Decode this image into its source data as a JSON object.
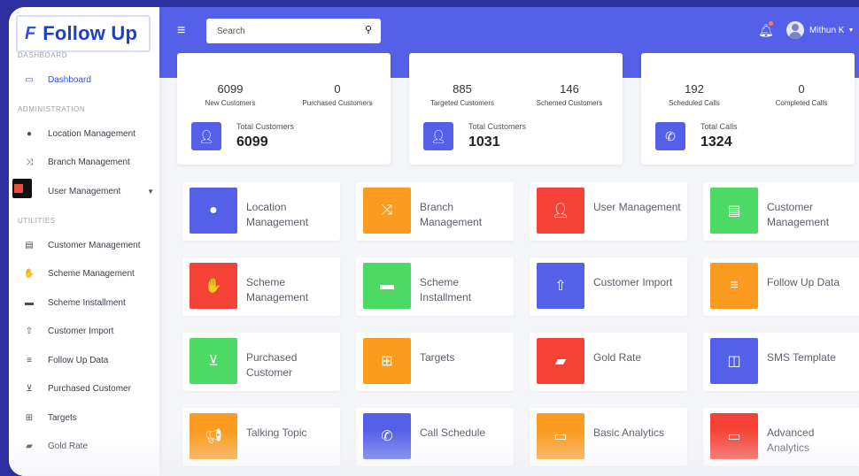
{
  "app": {
    "logo_mark": "F",
    "logo_text": "Follow Up"
  },
  "sidebar": {
    "sections": [
      {
        "label": "DASHBOARD"
      },
      {
        "label": "ADMINISTRATION"
      },
      {
        "label": "UTILITIES"
      }
    ],
    "items": [
      {
        "label": "Dashboard",
        "icon": "monitor-icon",
        "active": true
      },
      {
        "label": "Location Management",
        "icon": "location-pin-icon"
      },
      {
        "label": "Branch Management",
        "icon": "shuffle-icon"
      },
      {
        "label": "User Management",
        "icon": "user-icon"
      },
      {
        "label": "Customer Management",
        "icon": "id-card-icon"
      },
      {
        "label": "Scheme Management",
        "icon": "handshake-icon"
      },
      {
        "label": "Scheme Installment",
        "icon": "card-icon"
      },
      {
        "label": "Customer Import",
        "icon": "upload-icon"
      },
      {
        "label": "Follow Up Data",
        "icon": "list-icon"
      },
      {
        "label": "Purchased Customer",
        "icon": "cart-icon"
      },
      {
        "label": "Targets",
        "icon": "table-icon"
      },
      {
        "label": "Gold Rate",
        "icon": "wallet-icon"
      }
    ]
  },
  "header": {
    "search_placeholder": "Search",
    "user_name": "Mithun K"
  },
  "stats": [
    {
      "left_value": "6099",
      "left_label": "New Customers",
      "right_value": "0",
      "right_label": "Purchased Customers",
      "total_label": "Total Customers",
      "total_value": "6099",
      "icon": "user-icon"
    },
    {
      "left_value": "885",
      "left_label": "Targeted Customers",
      "right_value": "146",
      "right_label": "Schemed Customers",
      "total_label": "Total Customers",
      "total_value": "1031",
      "icon": "user-icon"
    },
    {
      "left_value": "192",
      "left_label": "Scheduled Calls",
      "right_value": "0",
      "right_label": "Completed Calls",
      "total_label": "Total Calls",
      "total_value": "1324",
      "icon": "phone-icon"
    }
  ],
  "tiles": [
    {
      "label": "Location Management",
      "color": "#5560e8",
      "icon": "location-pin-icon"
    },
    {
      "label": "Branch Management",
      "color": "#fb9b1f",
      "icon": "shuffle-icon"
    },
    {
      "label": "User Management",
      "color": "#f44336",
      "icon": "user-icon"
    },
    {
      "label": "Customer Management",
      "color": "#4cd964",
      "icon": "id-card-icon"
    },
    {
      "label": "Scheme Management",
      "color": "#f44336",
      "icon": "handshake-icon"
    },
    {
      "label": "Scheme Installment",
      "color": "#4cd964",
      "icon": "card-icon"
    },
    {
      "label": "Customer Import",
      "color": "#5560e8",
      "icon": "upload-icon"
    },
    {
      "label": "Follow Up Data",
      "color": "#fb9b1f",
      "icon": "list-icon"
    },
    {
      "label": "Purchased Customer",
      "color": "#4cd964",
      "icon": "cart-icon"
    },
    {
      "label": "Targets",
      "color": "#fb9b1f",
      "icon": "table-icon"
    },
    {
      "label": "Gold Rate",
      "color": "#f44336",
      "icon": "wallet-icon"
    },
    {
      "label": "SMS Template",
      "color": "#5560e8",
      "icon": "columns-icon"
    },
    {
      "label": "Talking Topic",
      "color": "#fb9b1f",
      "icon": "megaphone-icon"
    },
    {
      "label": "Call Schedule",
      "color": "#5560e8",
      "icon": "phone-icon"
    },
    {
      "label": "Basic Analytics",
      "color": "#fb9b1f",
      "icon": "desktop-icon"
    },
    {
      "label": "Advanced Analytics",
      "color": "#f44336",
      "icon": "desktop-icon"
    }
  ]
}
